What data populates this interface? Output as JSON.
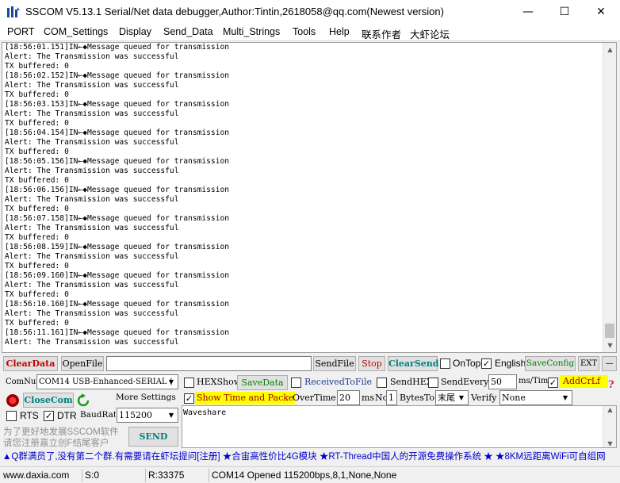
{
  "window": {
    "title": "SSCOM V5.13.1 Serial/Net data debugger,Author:Tintin,2618058@qq.com(Newest version)",
    "minimize": "—",
    "maximize": "☐",
    "close": "✕"
  },
  "menu": [
    "PORT",
    "COM_Settings",
    "Display",
    "Send_Data",
    "Multi_Strings",
    "Tools",
    "Help",
    "联系作者",
    "大虾论坛"
  ],
  "log_lines": [
    "[18:56:01.151]IN←◆Message queued for transmission",
    "Alert: The Transmission was successful",
    "TX buffered: 0",
    "[18:56:02.152]IN←◆Message queued for transmission",
    "Alert: The Transmission was successful",
    "TX buffered: 0",
    "[18:56:03.153]IN←◆Message queued for transmission",
    "Alert: The Transmission was successful",
    "TX buffered: 0",
    "[18:56:04.154]IN←◆Message queued for transmission",
    "Alert: The Transmission was successful",
    "TX buffered: 0",
    "[18:56:05.156]IN←◆Message queued for transmission",
    "Alert: The Transmission was successful",
    "TX buffered: 0",
    "[18:56:06.156]IN←◆Message queued for transmission",
    "Alert: The Transmission was successful",
    "TX buffered: 0",
    "[18:56:07.158]IN←◆Message queued for transmission",
    "Alert: The Transmission was successful",
    "TX buffered: 0",
    "[18:56:08.159]IN←◆Message queued for transmission",
    "Alert: The Transmission was successful",
    "TX buffered: 0",
    "[18:56:09.160]IN←◆Message queued for transmission",
    "Alert: The Transmission was successful",
    "TX buffered: 0",
    "[18:56:10.160]IN←◆Message queued for transmission",
    "Alert: The Transmission was successful",
    "TX buffered: 0",
    "[18:56:11.161]IN←◆Message queued for transmission",
    "Alert: The Transmission was successful"
  ],
  "toolbar": {
    "clear_data": "ClearData",
    "open_file": "OpenFile",
    "file_path": "",
    "send_file": "SendFile",
    "stop": "Stop",
    "clear_send": "ClearSend",
    "on_top": "OnTop",
    "english": "English",
    "save_config": "SaveConfig",
    "ext": "EXT"
  },
  "port": {
    "comnum_label": "ComNum",
    "comnum_value": "COM14 USB-Enhanced-SERIAL (",
    "close_com": "CloseCom",
    "more_settings": "More Settings",
    "rts": "RTS",
    "dtr": "DTR",
    "baud_label": "BaudRate",
    "baud_value": "115200"
  },
  "options": {
    "hexshow": "HEXShow",
    "save_data": "SaveData",
    "received_to_file": "ReceivedToFile",
    "sendhex": "SendHEX",
    "send_every": "SendEvery:",
    "send_every_value": "50",
    "ms_tim": "ms/Tim",
    "add_crlf": "AddCrLf",
    "show_time": "Show Time and Packe",
    "overtime": "OverTime:",
    "overtime_value": "20",
    "ms": "ms",
    "no": "No",
    "no_value": "1",
    "bytes_to": "BytesTo",
    "bytes_to_value": "末尾",
    "verify": "Verify",
    "verify_value": "None"
  },
  "send_text": "Waveshare",
  "promo_text": "为了更好地发展SSCOM软件\n请您注册嘉立创F结尾客户",
  "send_button": "SEND",
  "marquee": "▲Q群满员了,没有第二个群.有需要请在虾坛提问[注册] ★合宙高性价比4G模块 ★RT-Thread中国人的开源免费操作系统 ★ ★8KM远距离WiFi可自组网",
  "status": {
    "site": "www.daxia.com",
    "s": "S:0",
    "r": "R:33375",
    "port": "COM14 Opened  115200bps,8,1,None,None"
  },
  "colors": {
    "accent_red": "#c00000",
    "accent_teal": "#008080",
    "highlight_yellow": "#ffff00",
    "marquee_blue": "#0000cc"
  }
}
